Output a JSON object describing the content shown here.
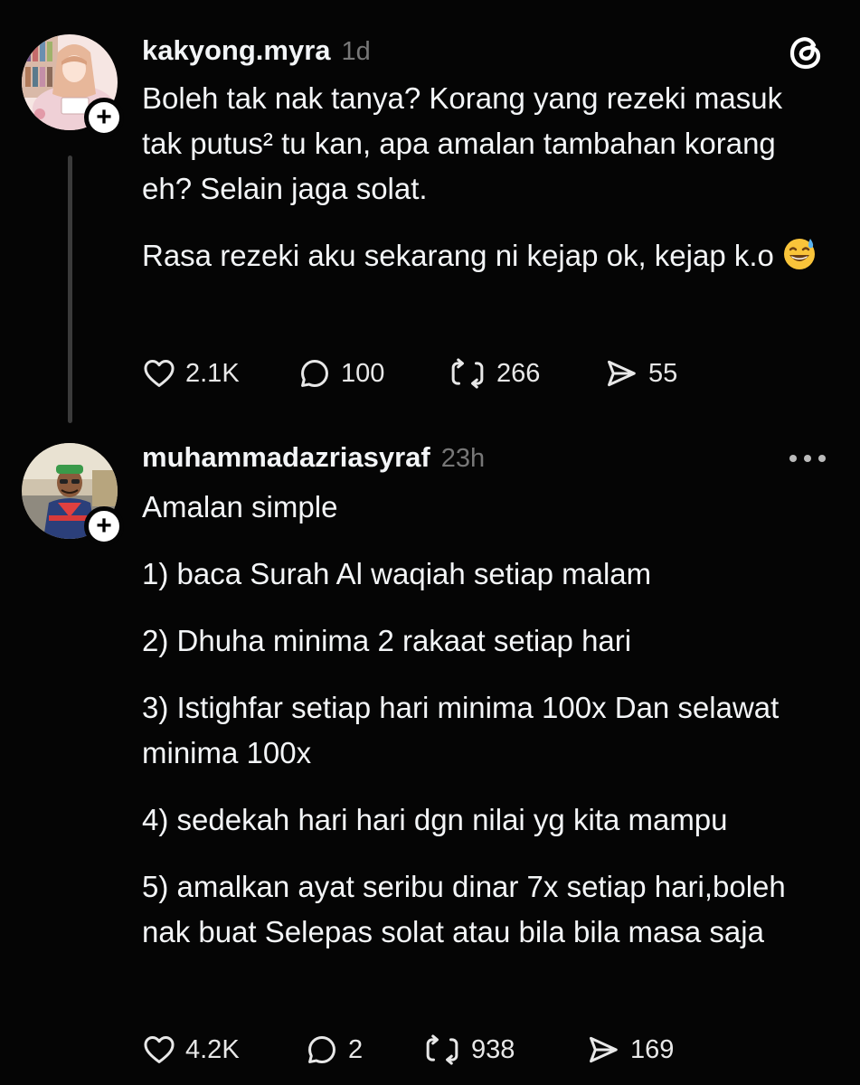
{
  "post1": {
    "username": "kakyong.myra",
    "time": "1d",
    "paragraphs": [
      "Boleh tak nak tanya? Korang yang rezeki masuk tak putus² tu kan, apa amalan tambahan korang eh? Selain jaga solat.",
      "Rasa rezeki aku sekarang ni kejap ok, kejap k.o"
    ],
    "emoji": "sweat-smile-emoji",
    "likes": "2.1K",
    "replies": "100",
    "reposts": "266",
    "shares": "55"
  },
  "post2": {
    "username": "muhammadazriasyraf",
    "time": "23h",
    "paragraphs": [
      "Amalan simple",
      "1) baca Surah Al waqiah setiap malam",
      "2) Dhuha minima 2 rakaat setiap hari",
      "3) Istighfar setiap hari minima 100x Dan selawat minima 100x",
      "4) sedekah hari hari dgn nilai yg kita mampu",
      "5) amalkan ayat seribu dinar 7x setiap hari,boleh nak buat Selepas solat atau bila bila masa saja"
    ],
    "likes": "4.2K",
    "replies": "2",
    "reposts": "938",
    "shares": "169"
  },
  "icons": {
    "app_logo": "threads-logo-icon",
    "like": "heart-icon",
    "reply": "comment-bubble-icon",
    "repost": "repost-arrows-icon",
    "share": "send-paper-plane-icon",
    "more": "more-dots-icon",
    "follow": "plus-icon"
  },
  "colors": {
    "background": "#050505",
    "text": "#f3f5f7",
    "muted": "#777777",
    "thread_line": "#3b3b3b"
  }
}
